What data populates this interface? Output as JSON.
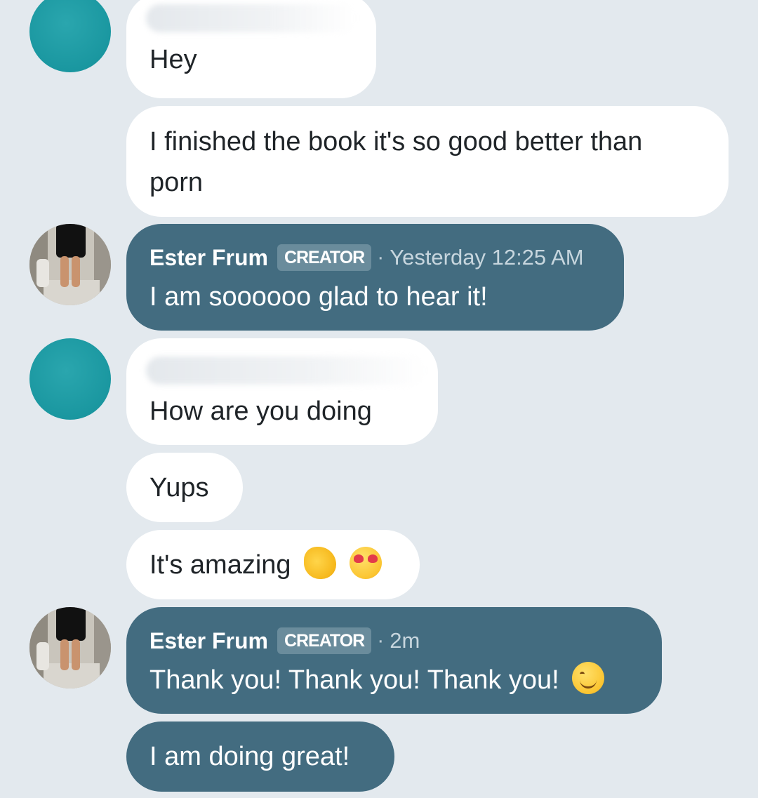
{
  "conversation": {
    "messages": [
      {
        "text": "Hey"
      },
      {
        "text": "I finished the book it's so good better than porn"
      },
      {
        "sender": "Ester Frum",
        "badge": "CREATOR",
        "separator": "·",
        "time": "Yesterday 12:25 AM",
        "text": "I am soooooo glad to hear it!"
      },
      {
        "text": "How are you doing"
      },
      {
        "text": "Yups"
      },
      {
        "text": "It's amazing"
      },
      {
        "sender": "Ester Frum",
        "badge": "CREATOR",
        "separator": "·",
        "time": "2m",
        "text": "Thank you! Thank you! Thank you!"
      },
      {
        "text": "I am doing great!"
      }
    ]
  },
  "icons": {
    "clap": "clapping-hands-emoji",
    "heart_eyes": "heart-eyes-emoji",
    "smile": "smiling-face-emoji"
  },
  "colors": {
    "background": "#e3e9ee",
    "incoming_bubble": "#ffffff",
    "outgoing_bubble": "#436c80",
    "teal_avatar": "#1a97a0",
    "badge": "#6a8c9c"
  }
}
